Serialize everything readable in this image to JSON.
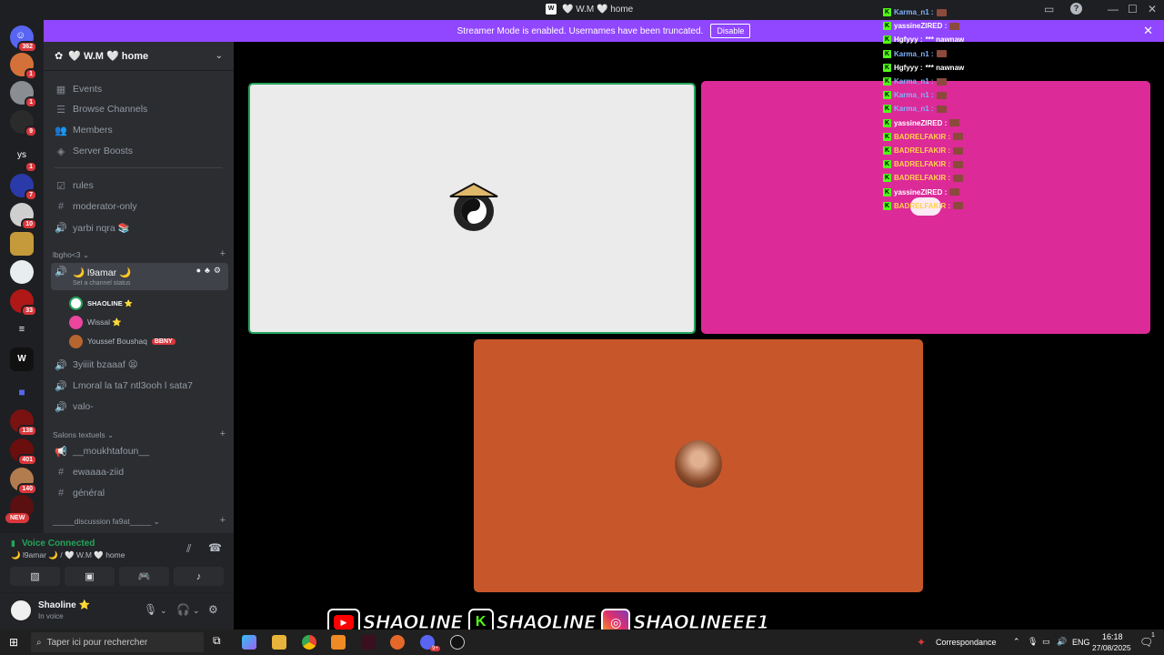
{
  "titlebar": {
    "title": "🤍 W.M 🤍 home",
    "help": "?",
    "min": "—",
    "max": "☐",
    "close": "✕"
  },
  "banner": {
    "text": "Streamer Mode is enabled. Usernames have been truncated.",
    "disable_label": "Disable"
  },
  "servers": {
    "badges": [
      "362",
      "1",
      "1",
      "9",
      "1",
      "7",
      "10",
      "33",
      "138",
      "401",
      "140"
    ],
    "ys_label": "ys",
    "new_label": "NEW"
  },
  "server": {
    "name": "🤍 W.M 🤍 home"
  },
  "nav": [
    "Events",
    "Browse Channels",
    "Members",
    "Server Boosts"
  ],
  "channels_top": [
    "rules",
    "moderator-only",
    "yarbi nqra 📚"
  ],
  "categories": {
    "lbgho": "lbgho<3",
    "salons": "Salons textuels",
    "discussion": "_____discussion fa9at_____"
  },
  "active_voice": {
    "name": "🌙 l9amar 🌙",
    "status_hint": "Set a channel status"
  },
  "voice_users": [
    {
      "name": "SHAOLINE ⭐"
    },
    {
      "name": "Wissal ⭐"
    },
    {
      "name": "Youssef Boushaq",
      "tag": "BBNY"
    }
  ],
  "voice_channels": [
    "3yiiiit bzaaaf 😫",
    "Lmoral la ta7 ntl3ooh l sata7",
    "valo-"
  ],
  "text_channels": [
    "__moukhtafoun__",
    "ewaaaa-ziid",
    "général"
  ],
  "voice_panel": {
    "status": "Voice Connected",
    "location": "🌙 l9amar 🌙 / 🤍 W.M 🤍 home"
  },
  "user": {
    "name": "Shaoline ⭐",
    "status": "In voice"
  },
  "chat": [
    {
      "user": "Karma_n1 :",
      "color": "#7fb3ff",
      "msg": ""
    },
    {
      "user": "yassineZIRED :",
      "color": "#ffffff",
      "msg": ""
    },
    {
      "user": "Hgfyyy :",
      "color": "#ffffff",
      "msg": "*** nawnaw"
    },
    {
      "user": "Karma_n1 :",
      "color": "#7fb3ff",
      "msg": ""
    },
    {
      "user": "Hgfyyy :",
      "color": "#ffffff",
      "msg": "*** nawnaw"
    },
    {
      "user": "Karma_n1 :",
      "color": "#7fb3ff",
      "msg": ""
    },
    {
      "user": "Karma_n1 :",
      "color": "#7fb3ff",
      "msg": ""
    },
    {
      "user": "Karma_n1 :",
      "color": "#7fb3ff",
      "msg": ""
    },
    {
      "user": "yassineZIRED :",
      "color": "#ffffff",
      "msg": ""
    },
    {
      "user": "BADRELFAKIR :",
      "color": "#ffd24a",
      "msg": ""
    },
    {
      "user": "BADRELFAKIR :",
      "color": "#ffd24a",
      "msg": ""
    },
    {
      "user": "BADRELFAKIR :",
      "color": "#ffd24a",
      "msg": ""
    },
    {
      "user": "BADRELFAKIR :",
      "color": "#ffd24a",
      "msg": ""
    },
    {
      "user": "yassineZIRED :",
      "color": "#ffffff",
      "msg": ""
    },
    {
      "user": "BADRELFAKIR :",
      "color": "#ffd24a",
      "msg": ""
    }
  ],
  "socials": {
    "youtube": "SHAOLINE",
    "kick": "SHAOLINE",
    "instagram": "SHAOLINEEE1"
  },
  "taskbar": {
    "search_placeholder": "Taper ici pour rechercher",
    "weather": "Correspondance",
    "lang": "ENG",
    "time": "16:18",
    "date": "27/08/2025",
    "discord_badge": "9+",
    "notif_count": "1"
  },
  "colors": {
    "discord_bg": "#2b2d31",
    "rail": "#1e1f22",
    "streamer_banner": "#9146ff",
    "kick_green": "#53fc18",
    "tile_pink": "#dc2a98",
    "tile_orange": "#c7572a",
    "tile_gray": "#ebebeb",
    "voice_green": "#23a55a"
  }
}
